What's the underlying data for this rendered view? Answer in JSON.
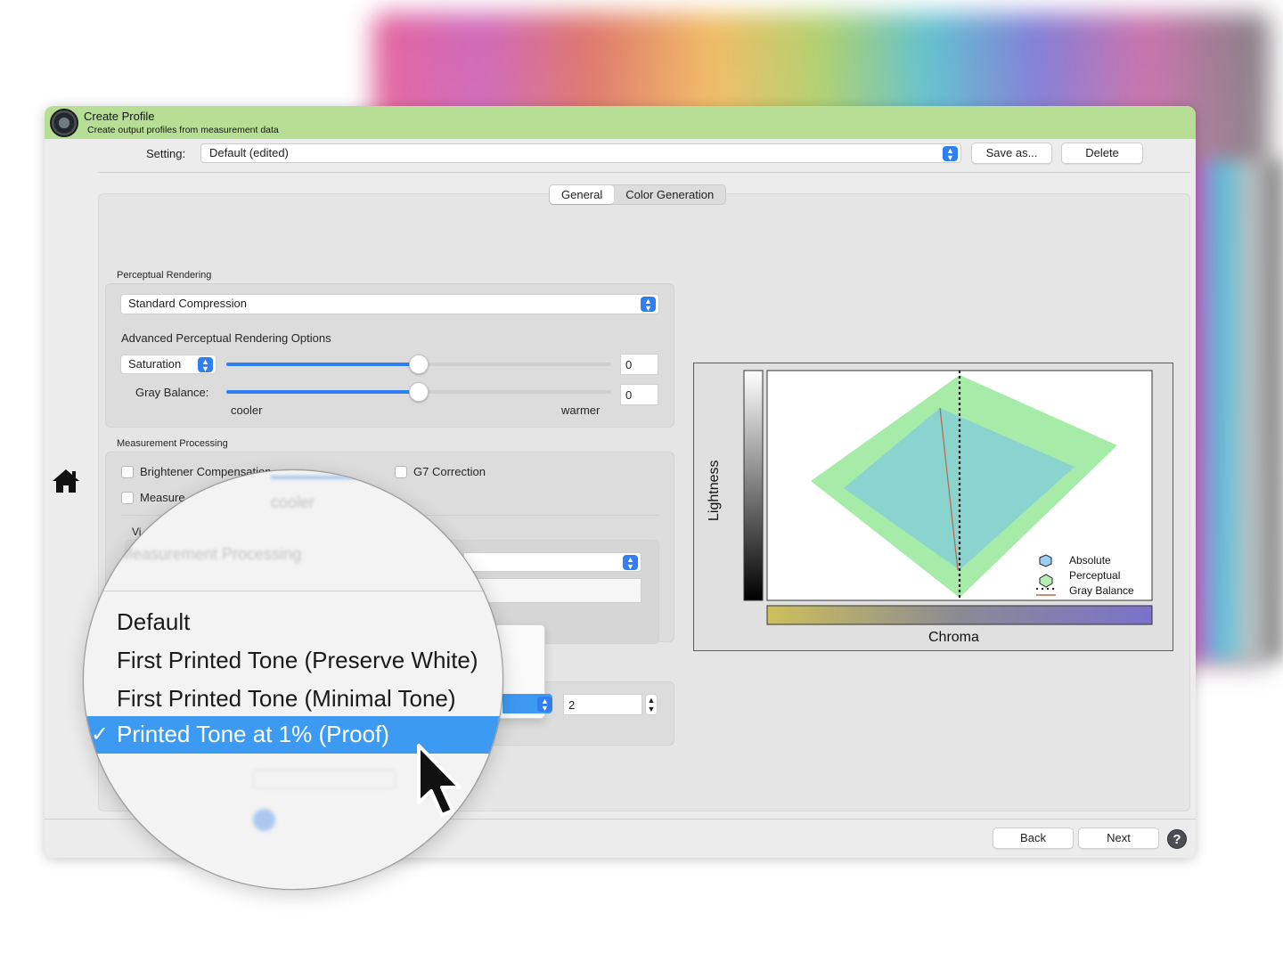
{
  "window": {
    "title": "Create Profile",
    "subtitle": "Create output profiles from measurement data"
  },
  "setting": {
    "label": "Setting:",
    "value": "Default (edited)",
    "save_as": "Save as...",
    "delete": "Delete"
  },
  "tabs": [
    {
      "label": "General",
      "active": true
    },
    {
      "label": "Color Generation",
      "active": false
    }
  ],
  "perceptual": {
    "group_label": "Perceptual Rendering",
    "method": "Standard Compression",
    "advanced_label": "Advanced Perceptual Rendering Options",
    "saturation_select": "Saturation",
    "saturation_value": "0",
    "saturation_level": 0.5,
    "gray_balance_label": "Gray Balance:",
    "gray_balance_value": "0",
    "gray_balance_level": 0.5,
    "cooler": "cooler",
    "warmer": "warmer"
  },
  "measurement": {
    "group_label": "Measurement Processing",
    "brightener": "Brightener Compensation",
    "g7": "G7 Correction",
    "measure_partial": "Measure",
    "v_partial": "Vi",
    "stepper_value": "2"
  },
  "navigation": {
    "back": "Back",
    "next": "Next",
    "help": "?"
  },
  "chart": {
    "y_label": "Lightness",
    "x_label": "Chroma",
    "legend": [
      "Absolute",
      "Perceptual",
      "Gray Balance"
    ],
    "colors": {
      "absolute": "#8bd3cf",
      "perceptual": "#a6eca8",
      "gray_balance": "#b5684a"
    }
  },
  "magnifier": {
    "menu_items": [
      "Default",
      "First Printed Tone (Preserve White)",
      "First Printed Tone (Minimal Tone)",
      "Printed Tone at 1% (Proof)"
    ],
    "selected_index": 3,
    "checkmark": "✓"
  },
  "icons": {
    "home": "home-icon",
    "chevron": "popup-chevron-icon",
    "cursor": "mouse-pointer-icon",
    "app": "app-logo-icon"
  }
}
